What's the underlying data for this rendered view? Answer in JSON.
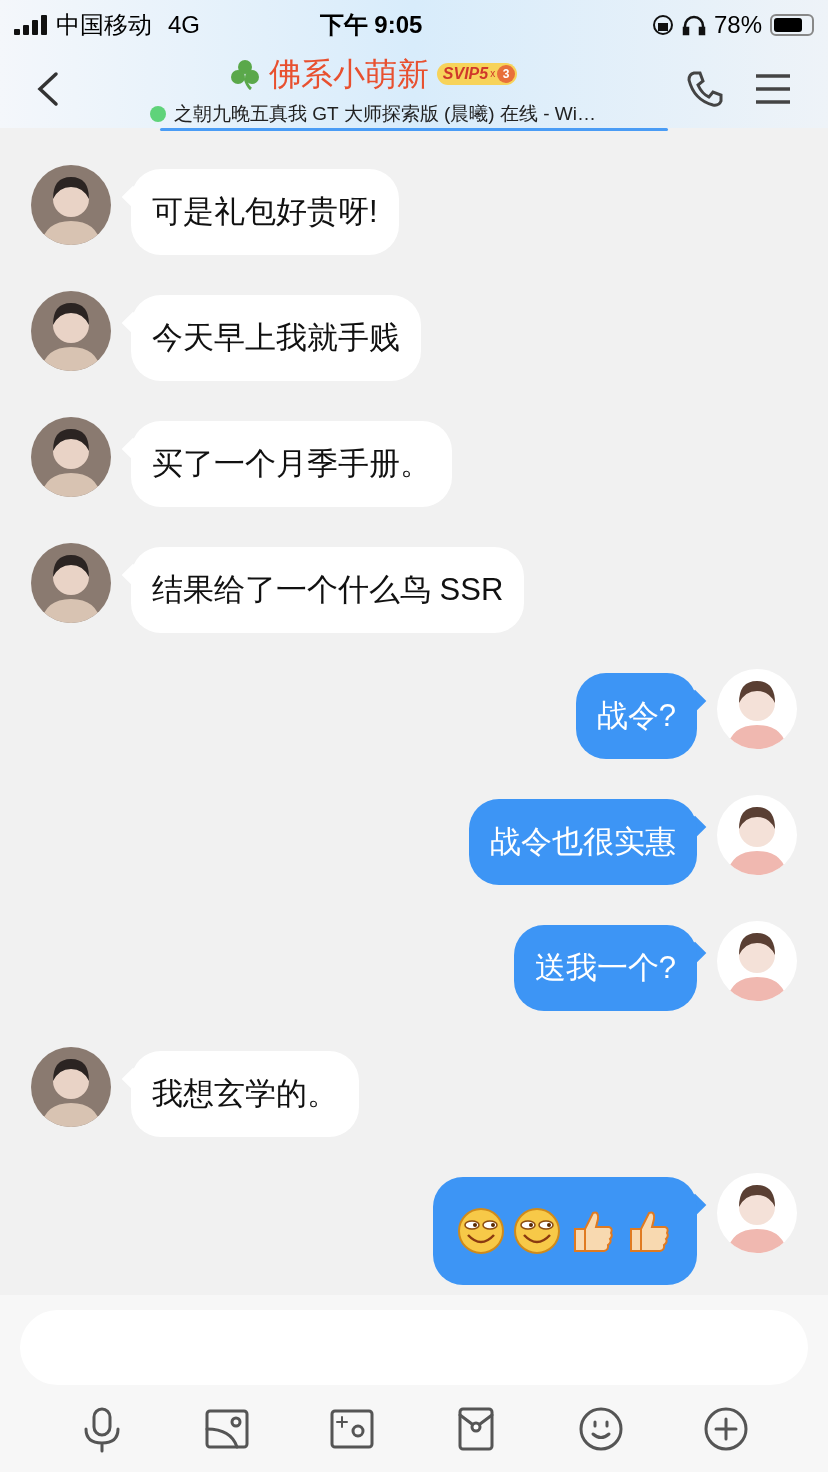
{
  "status_bar": {
    "carrier": "中国移动",
    "network": "4G",
    "time": "下午 9:05",
    "battery": "78%"
  },
  "header": {
    "title": "佛系小萌新",
    "badge": "SVIP5",
    "badge_x": "x",
    "badge_level": "3",
    "subtitle": "之朝九晚五真我 GT 大师探索版 (晨曦) 在线 - Wi…",
    "online": true
  },
  "messages": [
    {
      "outgoing": false,
      "kind": "text",
      "text": "可是礼包好贵呀!"
    },
    {
      "outgoing": false,
      "kind": "text",
      "text": "今天早上我就手贱"
    },
    {
      "outgoing": false,
      "kind": "text",
      "text": "买了一个月季手册。"
    },
    {
      "outgoing": false,
      "kind": "text",
      "text": "结果给了一个什么鸟 SSR"
    },
    {
      "outgoing": true,
      "kind": "text",
      "text": "战令?"
    },
    {
      "outgoing": true,
      "kind": "text",
      "text": "战令也很实惠"
    },
    {
      "outgoing": true,
      "kind": "text",
      "text": "送我一个?"
    },
    {
      "outgoing": false,
      "kind": "text",
      "text": "我想玄学的。"
    },
    {
      "outgoing": true,
      "kind": "emoji",
      "emojis": [
        {
          "kind": "smirk"
        },
        {
          "kind": "smirk"
        },
        {
          "kind": "thumbs_up"
        },
        {
          "kind": "thumbs_up"
        }
      ]
    }
  ],
  "toolbar": [
    {
      "kind": "mic"
    },
    {
      "kind": "image"
    },
    {
      "kind": "camera"
    },
    {
      "kind": "red_packet"
    },
    {
      "kind": "emoji"
    },
    {
      "kind": "plus"
    }
  ]
}
